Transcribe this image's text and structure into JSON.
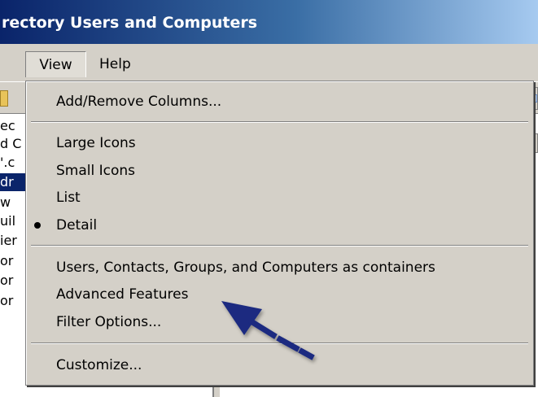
{
  "window": {
    "title": "rectory Users and Computers"
  },
  "menubar": {
    "items": [
      {
        "label": "View"
      },
      {
        "label": "Help"
      }
    ]
  },
  "tree": {
    "lines": [
      "ec",
      "d C",
      "'.c",
      "dr",
      "w",
      "uil",
      "ier",
      "or",
      "or",
      "or"
    ]
  },
  "view_menu": {
    "items": [
      {
        "label": "Add/Remove Columns..."
      },
      {
        "label": "Large Icons"
      },
      {
        "label": "Small Icons"
      },
      {
        "label": "List"
      },
      {
        "label": "Detail",
        "checked": true
      },
      {
        "label": "Users, Contacts, Groups, and Computers as containers"
      },
      {
        "label": "Advanced Features"
      },
      {
        "label": "Filter Options..."
      },
      {
        "label": "Customize..."
      }
    ]
  },
  "annotation": {
    "arrow_color": "#1a2a80"
  }
}
